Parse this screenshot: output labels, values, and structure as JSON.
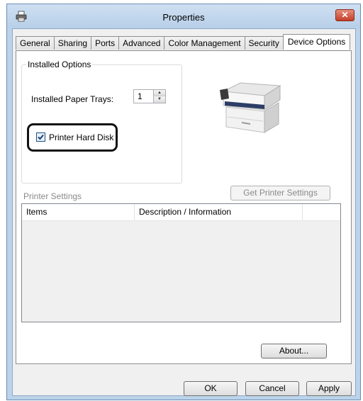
{
  "window": {
    "title": "Properties",
    "close_symbol": "✕"
  },
  "tabs": [
    {
      "label": "General",
      "active": false
    },
    {
      "label": "Sharing",
      "active": false
    },
    {
      "label": "Ports",
      "active": false
    },
    {
      "label": "Advanced",
      "active": false
    },
    {
      "label": "Color Management",
      "active": false
    },
    {
      "label": "Security",
      "active": false
    },
    {
      "label": "Device Options",
      "active": true
    }
  ],
  "installed_options": {
    "group_title": "Installed Options",
    "paper_trays_label": "Installed Paper Trays:",
    "paper_trays_value": "1",
    "hard_disk_label": "Printer Hard Disk",
    "hard_disk_checked": true
  },
  "printer_settings": {
    "section_label": "Printer Settings",
    "get_settings_button": "Get Printer Settings",
    "columns": [
      "Items",
      "Description / Information"
    ],
    "rows": []
  },
  "buttons": {
    "about": "About...",
    "ok": "OK",
    "cancel": "Cancel",
    "apply": "Apply"
  },
  "colors": {
    "frame": "#bcd3ea",
    "close_button": "#c43f28",
    "checkbox_check": "#1c3f6e"
  },
  "icons": {
    "title": "printer-icon",
    "device": "printer-image"
  }
}
